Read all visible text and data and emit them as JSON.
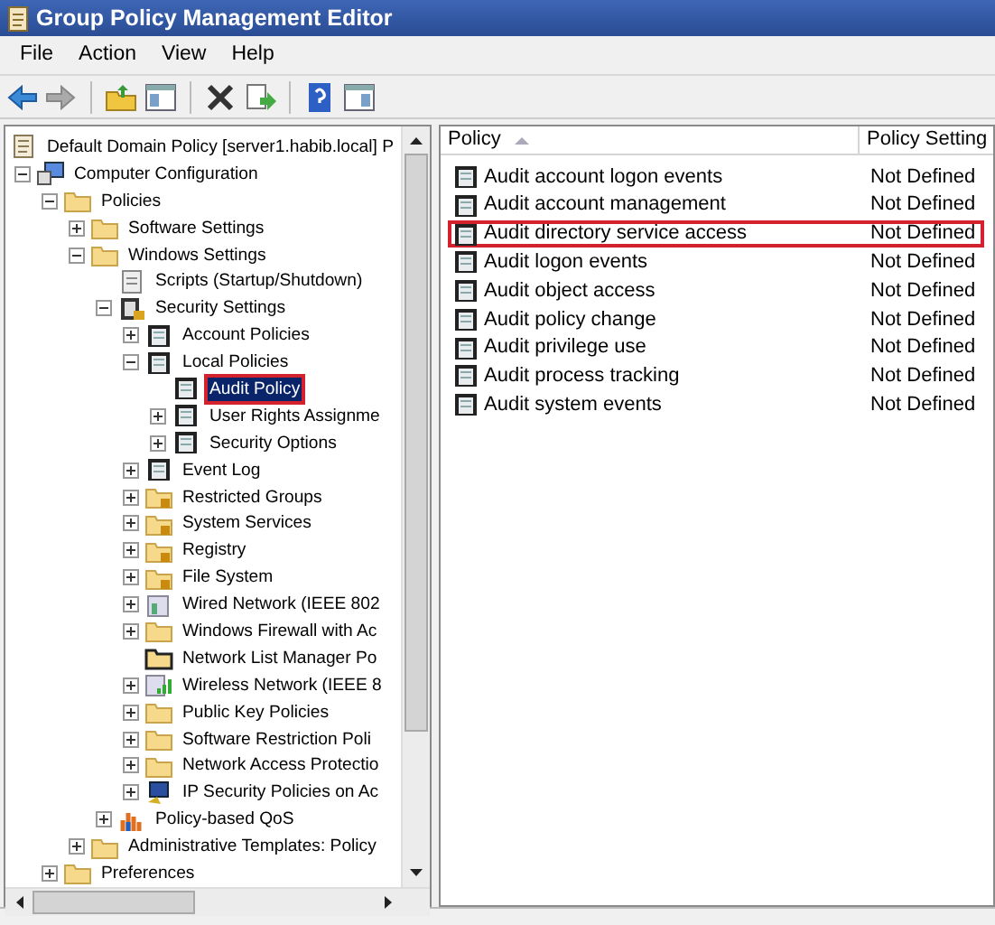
{
  "window": {
    "title": "Group Policy Management Editor"
  },
  "menu": [
    "File",
    "Action",
    "View",
    "Help"
  ],
  "tree": [
    {
      "label": "Default Domain Policy [server1.habib.local] P",
      "kind": "document",
      "selected": false,
      "outlined": false,
      "children": [
        {
          "label": "Computer Configuration",
          "kind": "computer",
          "expanded": true,
          "selected": false,
          "outlined": false,
          "children": [
            {
              "label": "Policies",
              "kind": "folder",
              "expanded": true,
              "selected": false,
              "outlined": false,
              "children": [
                {
                  "label": "Software Settings",
                  "kind": "folder",
                  "expanded": false,
                  "selected": false,
                  "outlined": false
                },
                {
                  "label": "Windows Settings",
                  "kind": "folder",
                  "expanded": true,
                  "selected": false,
                  "outlined": false,
                  "children": [
                    {
                      "label": "Scripts (Startup/Shutdown)",
                      "kind": "script",
                      "selected": false,
                      "outlined": false
                    },
                    {
                      "label": "Security Settings",
                      "kind": "security",
                      "expanded": true,
                      "selected": false,
                      "outlined": false,
                      "children": [
                        {
                          "label": "Account Policies",
                          "kind": "policy",
                          "expanded": false,
                          "selected": false,
                          "outlined": false
                        },
                        {
                          "label": "Local Policies",
                          "kind": "policy",
                          "expanded": true,
                          "selected": false,
                          "outlined": false,
                          "children": [
                            {
                              "label": "Audit Policy",
                              "kind": "policy",
                              "selected": true,
                              "outlined": true
                            },
                            {
                              "label": "User Rights Assignme",
                              "kind": "policy",
                              "expanded": false,
                              "selected": false,
                              "outlined": false
                            },
                            {
                              "label": "Security Options",
                              "kind": "policy",
                              "expanded": false,
                              "selected": false,
                              "outlined": false
                            }
                          ]
                        },
                        {
                          "label": "Event Log",
                          "kind": "policy",
                          "expanded": false,
                          "selected": false,
                          "outlined": false
                        },
                        {
                          "label": "Restricted Groups",
                          "kind": "lockfolder",
                          "expanded": false,
                          "selected": false,
                          "outlined": false
                        },
                        {
                          "label": "System Services",
                          "kind": "lockfolder",
                          "expanded": false,
                          "selected": false,
                          "outlined": false
                        },
                        {
                          "label": "Registry",
                          "kind": "lockfolder",
                          "expanded": false,
                          "selected": false,
                          "outlined": false
                        },
                        {
                          "label": "File System",
                          "kind": "lockfolder",
                          "expanded": false,
                          "selected": false,
                          "outlined": false
                        },
                        {
                          "label": "Wired Network (IEEE 802",
                          "kind": "wired",
                          "expanded": false,
                          "selected": false,
                          "outlined": false
                        },
                        {
                          "label": "Windows Firewall with Ac",
                          "kind": "folder",
                          "expanded": false,
                          "selected": false,
                          "outlined": false
                        },
                        {
                          "label": "Network List Manager Po",
                          "kind": "darkfolder",
                          "selected": false,
                          "outlined": false
                        },
                        {
                          "label": "Wireless Network (IEEE 8",
                          "kind": "wireless",
                          "expanded": false,
                          "selected": false,
                          "outlined": false
                        },
                        {
                          "label": "Public Key Policies",
                          "kind": "folder",
                          "expanded": false,
                          "selected": false,
                          "outlined": false
                        },
                        {
                          "label": "Software Restriction Poli",
                          "kind": "folder",
                          "expanded": false,
                          "selected": false,
                          "outlined": false
                        },
                        {
                          "label": "Network Access Protectio",
                          "kind": "folder",
                          "expanded": false,
                          "selected": false,
                          "outlined": false
                        },
                        {
                          "label": "IP Security Policies on Ac",
                          "kind": "ipsec",
                          "expanded": false,
                          "selected": false,
                          "outlined": false
                        }
                      ]
                    },
                    {
                      "label": "Policy-based QoS",
                      "kind": "chart",
                      "expanded": false,
                      "selected": false,
                      "outlined": false
                    }
                  ]
                },
                {
                  "label": "Administrative Templates: Policy",
                  "kind": "folder",
                  "expanded": false,
                  "selected": false,
                  "outlined": false
                }
              ]
            },
            {
              "label": "Preferences",
              "kind": "folder",
              "expanded": false,
              "selected": false,
              "outlined": false
            }
          ]
        }
      ]
    }
  ],
  "list": {
    "columns": [
      "Policy",
      "Policy Setting"
    ],
    "rows": [
      {
        "policy": "Audit account logon events",
        "setting": "Not Defined",
        "outlined": false
      },
      {
        "policy": "Audit account management",
        "setting": "Not Defined",
        "outlined": false
      },
      {
        "policy": "Audit directory service access",
        "setting": "Not Defined",
        "outlined": true
      },
      {
        "policy": "Audit logon events",
        "setting": "Not Defined",
        "outlined": false
      },
      {
        "policy": "Audit object access",
        "setting": "Not Defined",
        "outlined": false
      },
      {
        "policy": "Audit policy change",
        "setting": "Not Defined",
        "outlined": false
      },
      {
        "policy": "Audit privilege use",
        "setting": "Not Defined",
        "outlined": false
      },
      {
        "policy": "Audit process tracking",
        "setting": "Not Defined",
        "outlined": false
      },
      {
        "policy": "Audit system events",
        "setting": "Not Defined",
        "outlined": false
      }
    ]
  }
}
